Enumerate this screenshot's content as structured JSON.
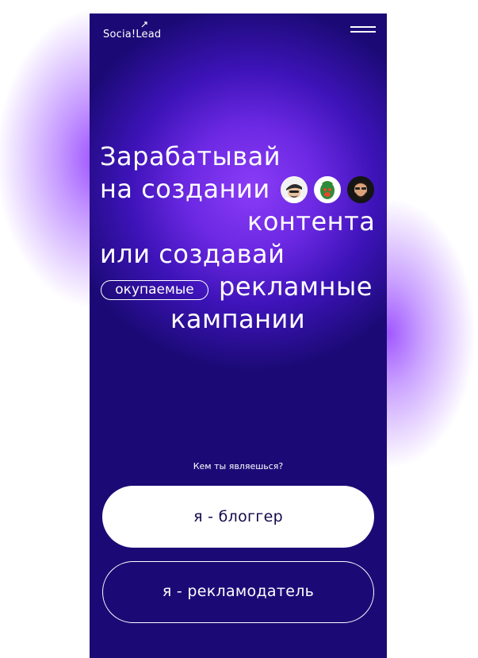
{
  "header": {
    "logo_text": "Socia!Lead",
    "menu_icon": "hamburger-menu-icon"
  },
  "hero": {
    "line1": "Зарабатывай",
    "line2": "на создании",
    "line3": "контента",
    "line4": "или создавай",
    "pill": "окупаемые",
    "line5": "рекламные",
    "line6": "кампании",
    "avatars": [
      "avatar-icon",
      "avatar-icon",
      "avatar-icon"
    ]
  },
  "role_select": {
    "question": "Кем ты являешься?",
    "blogger_label": "я - блоггер",
    "advertiser_label": "я - рекламодатель"
  },
  "colors": {
    "background": "#1b0a76",
    "accent": "#8b3cf7",
    "text": "#ffffff",
    "button_text_dark": "#140b4a"
  }
}
